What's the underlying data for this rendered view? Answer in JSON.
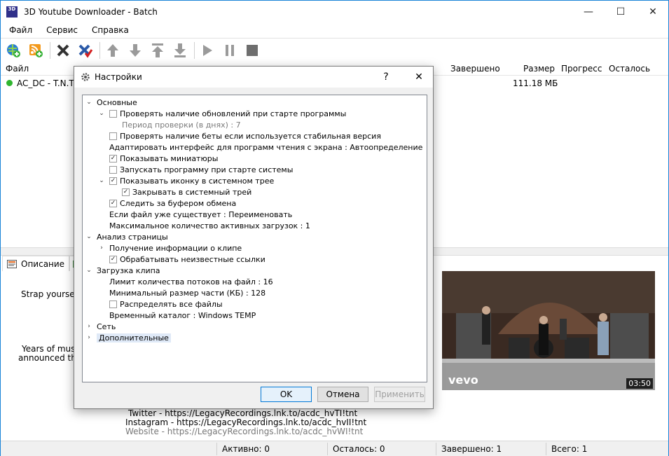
{
  "window": {
    "title": "3D Youtube Downloader - Batch",
    "app_icon_text": "3D",
    "minimize": "—",
    "maximize": "☐",
    "close": "✕"
  },
  "menu": [
    "Файл",
    "Сервис",
    "Справка"
  ],
  "toolbar": {
    "icons": [
      "add-link-icon",
      "add-feed-icon",
      "delete-icon",
      "delete-completed-icon",
      "move-up-icon",
      "move-down-icon",
      "move-top-icon",
      "move-bottom-icon",
      "play-icon",
      "pause-icon",
      "stop-icon"
    ]
  },
  "list": {
    "headers": {
      "file": "Файл",
      "completed": "Завершено",
      "size": "Размер",
      "progress": "Прогресс",
      "remaining": "Осталось"
    },
    "rows": [
      {
        "file": "AC_DC - T.N.T.",
        "size": "111.18 МБ",
        "status_color": "#2fb52f"
      }
    ]
  },
  "bottom": {
    "tab_description": "Описание",
    "desc_lines": [
      "Strap yourself in",
      "Years of musica",
      "announced the a",
      "Twitter - https://LegacyRecordings.lnk.to/acdc_hvTI!tnt",
      "Instagram - https://LegacyRecordings.lnk.to/acdc_hvII!tnt",
      "Website - https://LegacyRecordings.lnk.to/acdc_hvWI!tnt"
    ],
    "thumb": {
      "logo": "vevo",
      "duration": "03:50"
    }
  },
  "status": {
    "active": "Активно: 0",
    "remaining": "Осталось: 0",
    "completed": "Завершено: 1",
    "total": "Всего: 1"
  },
  "dialog": {
    "title": "Настройки",
    "help": "?",
    "close": "✕",
    "tree": [
      {
        "text": "Основные",
        "level": 0,
        "exp": "open"
      },
      {
        "text": "Проверять наличие обновлений при старте программы",
        "level": 1,
        "exp": "open",
        "check": false
      },
      {
        "text": "Период проверки (в днях) : 7",
        "level": 2,
        "dim": true
      },
      {
        "text": "Проверять наличие беты если используется стабильная версия",
        "level": 1,
        "check": false
      },
      {
        "text": "Адаптировать интерфейс для программ чтения с экрана : Автоопределение",
        "level": 1
      },
      {
        "text": "Показывать миниатюры",
        "level": 1,
        "check": true
      },
      {
        "text": "Запускать программу при старте системы",
        "level": 1,
        "check": false
      },
      {
        "text": "Показывать иконку в системном трее",
        "level": 1,
        "exp": "open",
        "check": true
      },
      {
        "text": "Закрывать в системный трей",
        "level": 2,
        "check": true
      },
      {
        "text": "Следить за буфером обмена",
        "level": 1,
        "check": true
      },
      {
        "text": "Если файл уже существует : Переименовать",
        "level": 1
      },
      {
        "text": "Максимальное количество активных загрузок : 1",
        "level": 1
      },
      {
        "text": "Анализ страницы",
        "level": 0,
        "exp": "open"
      },
      {
        "text": "Получение информации о клипе",
        "level": 1,
        "exp": "closed"
      },
      {
        "text": "Обрабатывать неизвестные ссылки",
        "level": 1,
        "check": true
      },
      {
        "text": "Загрузка клипа",
        "level": 0,
        "exp": "open"
      },
      {
        "text": "Лимит количества потоков на файл : 16",
        "level": 1
      },
      {
        "text": "Минимальный размер части (КБ) : 128",
        "level": 1
      },
      {
        "text": "Распределять все файлы",
        "level": 1,
        "check": false
      },
      {
        "text": "Временный каталог : Windows TEMP",
        "level": 1
      },
      {
        "text": "Сеть",
        "level": 0,
        "exp": "closed"
      },
      {
        "text": "Дополнительные",
        "level": 0,
        "exp": "closed",
        "selected": true
      }
    ],
    "buttons": {
      "ok": "OK",
      "cancel": "Отмена",
      "apply": "Применить"
    }
  }
}
